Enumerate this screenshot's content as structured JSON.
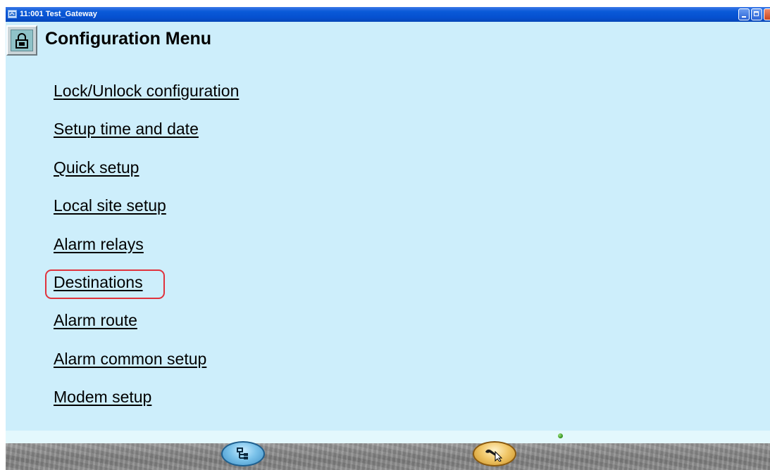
{
  "window": {
    "title": "11:001 Test_Gateway"
  },
  "header": {
    "title": "Configuration Menu"
  },
  "menu": {
    "items": [
      {
        "label": "Lock/Unlock configuration"
      },
      {
        "label": "Setup time and date"
      },
      {
        "label": "Quick setup"
      },
      {
        "label": "Local site setup"
      },
      {
        "label": "Alarm relays"
      },
      {
        "label": "Destinations"
      },
      {
        "label": "Alarm route"
      },
      {
        "label": "Alarm common setup"
      },
      {
        "label": "Modem setup"
      }
    ],
    "highlighted_item": "Destinations"
  },
  "icons": {
    "lock": "lock-icon",
    "tree": "tree-view-icon",
    "tools": "wrench-cursor-icon",
    "status": "status-led-icon"
  },
  "colors": {
    "client_background": "#cdeefb",
    "highlight_border": "#e0323c",
    "status_led": "#3fa81f",
    "titlebar": "#0a5ad8"
  }
}
